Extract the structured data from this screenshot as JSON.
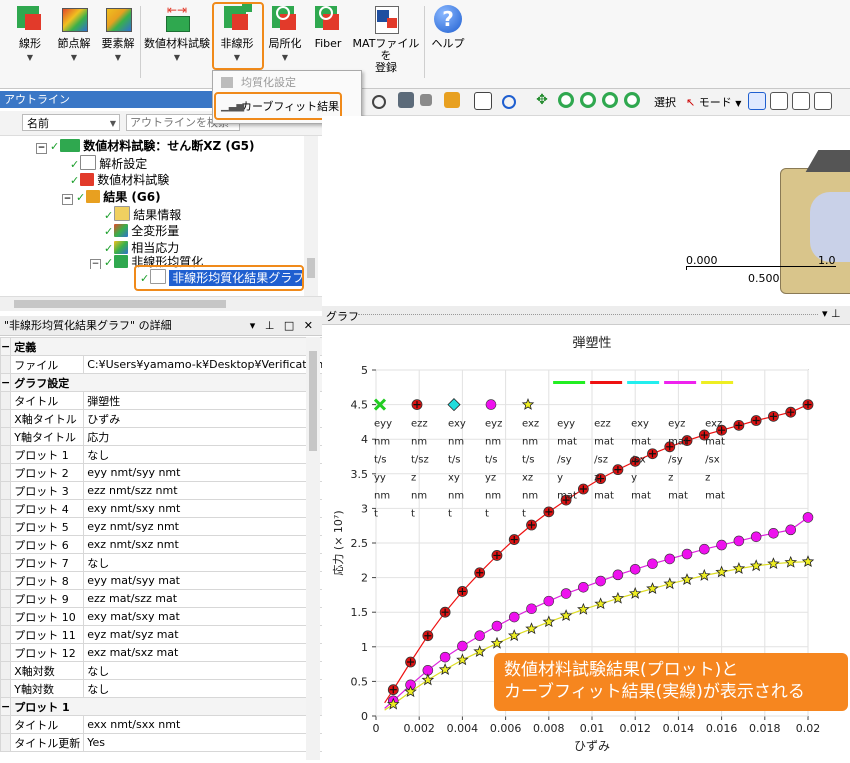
{
  "ribbon": {
    "buttons": [
      {
        "label1": "線形",
        "label2": "",
        "icon": "linear-icon"
      },
      {
        "label1": "節点解",
        "label2": "",
        "icon": "nodal-solution-icon"
      },
      {
        "label1": "要素解",
        "label2": "",
        "icon": "element-solution-icon"
      },
      {
        "label1": "数値材料試験",
        "label2": "",
        "icon": "material-test-icon"
      },
      {
        "label1": "非線形",
        "label2": "",
        "icon": "nonlinear-icon"
      },
      {
        "label1": "局所化",
        "label2": "",
        "icon": "localization-icon"
      },
      {
        "label1": "Fiber",
        "label2": "",
        "icon": "fiber-icon"
      },
      {
        "label1": "MATファイルを",
        "label2": "登録",
        "icon": "mat-file-icon"
      },
      {
        "label1": "ヘルプ",
        "label2": "",
        "icon": "help-icon"
      }
    ],
    "dropdown": {
      "item1": "均質化設定",
      "item2": "カーブフィット結果"
    }
  },
  "outline": {
    "title": "アウトライン",
    "name_column": "名前",
    "search_placeholder": "アウトラインを検索",
    "nodes": {
      "root": "数値材料試験：せん断XZ (G5)",
      "analysis": "解析設定",
      "material_test": "数値材料試験",
      "results": "結果 (G6)",
      "result_info": "結果情報",
      "total_def": "全変形量",
      "equiv_stress": "相当応力",
      "nonlinear": "非線形均質化",
      "graph": "非線形均質化結果グラフ"
    }
  },
  "details": {
    "title": "\"非線形均質化結果グラフ\" の詳細",
    "sections": {
      "def": "定義",
      "graph": "グラフ設定",
      "plot1": "プロット 1"
    },
    "rows": [
      {
        "k": "ファイル",
        "v": "C:¥Users¥yamamo-k¥Desktop¥Verification..."
      },
      {
        "k": "タイトル",
        "v": "弾塑性"
      },
      {
        "k": "X軸タイトル",
        "v": "ひずみ"
      },
      {
        "k": "Y軸タイトル",
        "v": "応力"
      },
      {
        "k": "プロット 1",
        "v": "なし"
      },
      {
        "k": "プロット 2",
        "v": "eyy nmt/syy nmt"
      },
      {
        "k": "プロット 3",
        "v": "ezz nmt/szz nmt"
      },
      {
        "k": "プロット 4",
        "v": "exy nmt/sxy nmt"
      },
      {
        "k": "プロット 5",
        "v": "eyz nmt/syz nmt"
      },
      {
        "k": "プロット 6",
        "v": "exz nmt/sxz nmt"
      },
      {
        "k": "プロット 7",
        "v": "なし"
      },
      {
        "k": "プロット 8",
        "v": "eyy mat/syy mat"
      },
      {
        "k": "プロット 9",
        "v": "ezz mat/szz mat"
      },
      {
        "k": "プロット 10",
        "v": "exy mat/sxy mat"
      },
      {
        "k": "プロット 11",
        "v": "eyz mat/syz mat"
      },
      {
        "k": "プロット 12",
        "v": "exz mat/sxz mat"
      },
      {
        "k": "X軸対数",
        "v": "なし"
      },
      {
        "k": "Y軸対数",
        "v": "なし"
      },
      {
        "k": "タイトル",
        "v": "exx nmt/sxx nmt"
      },
      {
        "k": "タイトル更新",
        "v": "Yes"
      }
    ]
  },
  "toolbar": {
    "select_label": "選択",
    "mode_label": "モード"
  },
  "viewport": {
    "scale_left": "0.000",
    "scale_mid": "0.500",
    "scale_right": "1.0"
  },
  "graph_panel": {
    "title": "グラフ"
  },
  "annotation": {
    "line1": "数値材料試験結果(プロット)と",
    "line2": "カーブフィット結果(実線)が表示される"
  },
  "colors": {
    "accent": "#f08a1a",
    "panel_title": "#3a77c6",
    "callout": "#f6861f"
  },
  "chart_data": {
    "type": "line",
    "title": "弾塑性",
    "xlabel": "ひずみ",
    "ylabel": "応力 (× 10⁷)",
    "xlim": [
      0,
      0.02
    ],
    "ylim": [
      0,
      5
    ],
    "xticks": [
      "0",
      "0.002",
      "0.004",
      "0.006",
      "0.008",
      "0.01",
      "0.012",
      "0.014",
      "0.016",
      "0.018",
      "0.02"
    ],
    "yticks": [
      "0",
      "0.5",
      "1",
      "1.5",
      "2",
      "2.5",
      "3",
      "3.5",
      "4",
      "4.5",
      "5"
    ],
    "legend_markers": [
      {
        "lines": [
          "eyy",
          "nm",
          "t/s",
          "yy",
          "nm",
          "t"
        ],
        "marker": "x",
        "color": "#22cc22"
      },
      {
        "lines": [
          "ezz",
          "nm",
          "t/sz",
          "z",
          "nm",
          "t"
        ],
        "marker": "plus",
        "color": "#dd1111"
      },
      {
        "lines": [
          "exy",
          "nm",
          "t/s",
          "xy",
          "nm",
          "t"
        ],
        "marker": "diamond",
        "color": "#22dddd"
      },
      {
        "lines": [
          "eyz",
          "nm",
          "t/s",
          "yz",
          "nm",
          "t"
        ],
        "marker": "circle",
        "color": "#ee11ee"
      },
      {
        "lines": [
          "exz",
          "nm",
          "t/s",
          "xz",
          "nm",
          "t"
        ],
        "marker": "star",
        "color": "#eeee22"
      }
    ],
    "legend_lines": [
      {
        "lines": [
          "eyy",
          "mat",
          "/sy",
          "y",
          "mat"
        ],
        "color": "#22ee22"
      },
      {
        "lines": [
          "ezz",
          "mat",
          "/sz",
          "z",
          "mat"
        ],
        "color": "#ee1111"
      },
      {
        "lines": [
          "exy",
          "mat",
          "/sx",
          "y",
          "mat"
        ],
        "color": "#22eeee"
      },
      {
        "lines": [
          "eyz",
          "mat",
          "/sy",
          "z",
          "mat"
        ],
        "color": "#ee22ee"
      },
      {
        "lines": [
          "exz",
          "mat",
          "/sx",
          "z",
          "mat"
        ],
        "color": "#eeee22"
      }
    ],
    "x": [
      0.0008,
      0.0016,
      0.0024,
      0.0032,
      0.004,
      0.0048,
      0.0056,
      0.0064,
      0.0072,
      0.008,
      0.0088,
      0.0096,
      0.0104,
      0.0112,
      0.012,
      0.0128,
      0.0136,
      0.0144,
      0.0152,
      0.016,
      0.0168,
      0.0176,
      0.0184,
      0.0192,
      0.02
    ],
    "series": [
      {
        "marker": "plus",
        "color": "#dd1111",
        "line": "#ee1111",
        "values": [
          0.38,
          0.78,
          1.16,
          1.5,
          1.8,
          2.07,
          2.32,
          2.55,
          2.76,
          2.95,
          3.12,
          3.28,
          3.43,
          3.56,
          3.68,
          3.79,
          3.89,
          3.98,
          4.06,
          4.13,
          4.2,
          4.27,
          4.33,
          4.39,
          4.5
        ]
      },
      {
        "marker": "circle",
        "color": "#ee11ee",
        "line": "#dd22dd",
        "values": [
          0.22,
          0.45,
          0.66,
          0.85,
          1.01,
          1.16,
          1.3,
          1.43,
          1.55,
          1.66,
          1.77,
          1.86,
          1.95,
          2.04,
          2.12,
          2.2,
          2.27,
          2.34,
          2.41,
          2.47,
          2.53,
          2.59,
          2.64,
          2.69,
          2.87
        ]
      },
      {
        "marker": "star",
        "color": "#eeee22",
        "line": "#dddd22",
        "values": [
          0.17,
          0.35,
          0.52,
          0.67,
          0.81,
          0.93,
          1.05,
          1.16,
          1.26,
          1.36,
          1.45,
          1.54,
          1.62,
          1.7,
          1.77,
          1.84,
          1.91,
          1.97,
          2.03,
          2.08,
          2.13,
          2.17,
          2.2,
          2.22,
          2.23
        ]
      }
    ]
  }
}
